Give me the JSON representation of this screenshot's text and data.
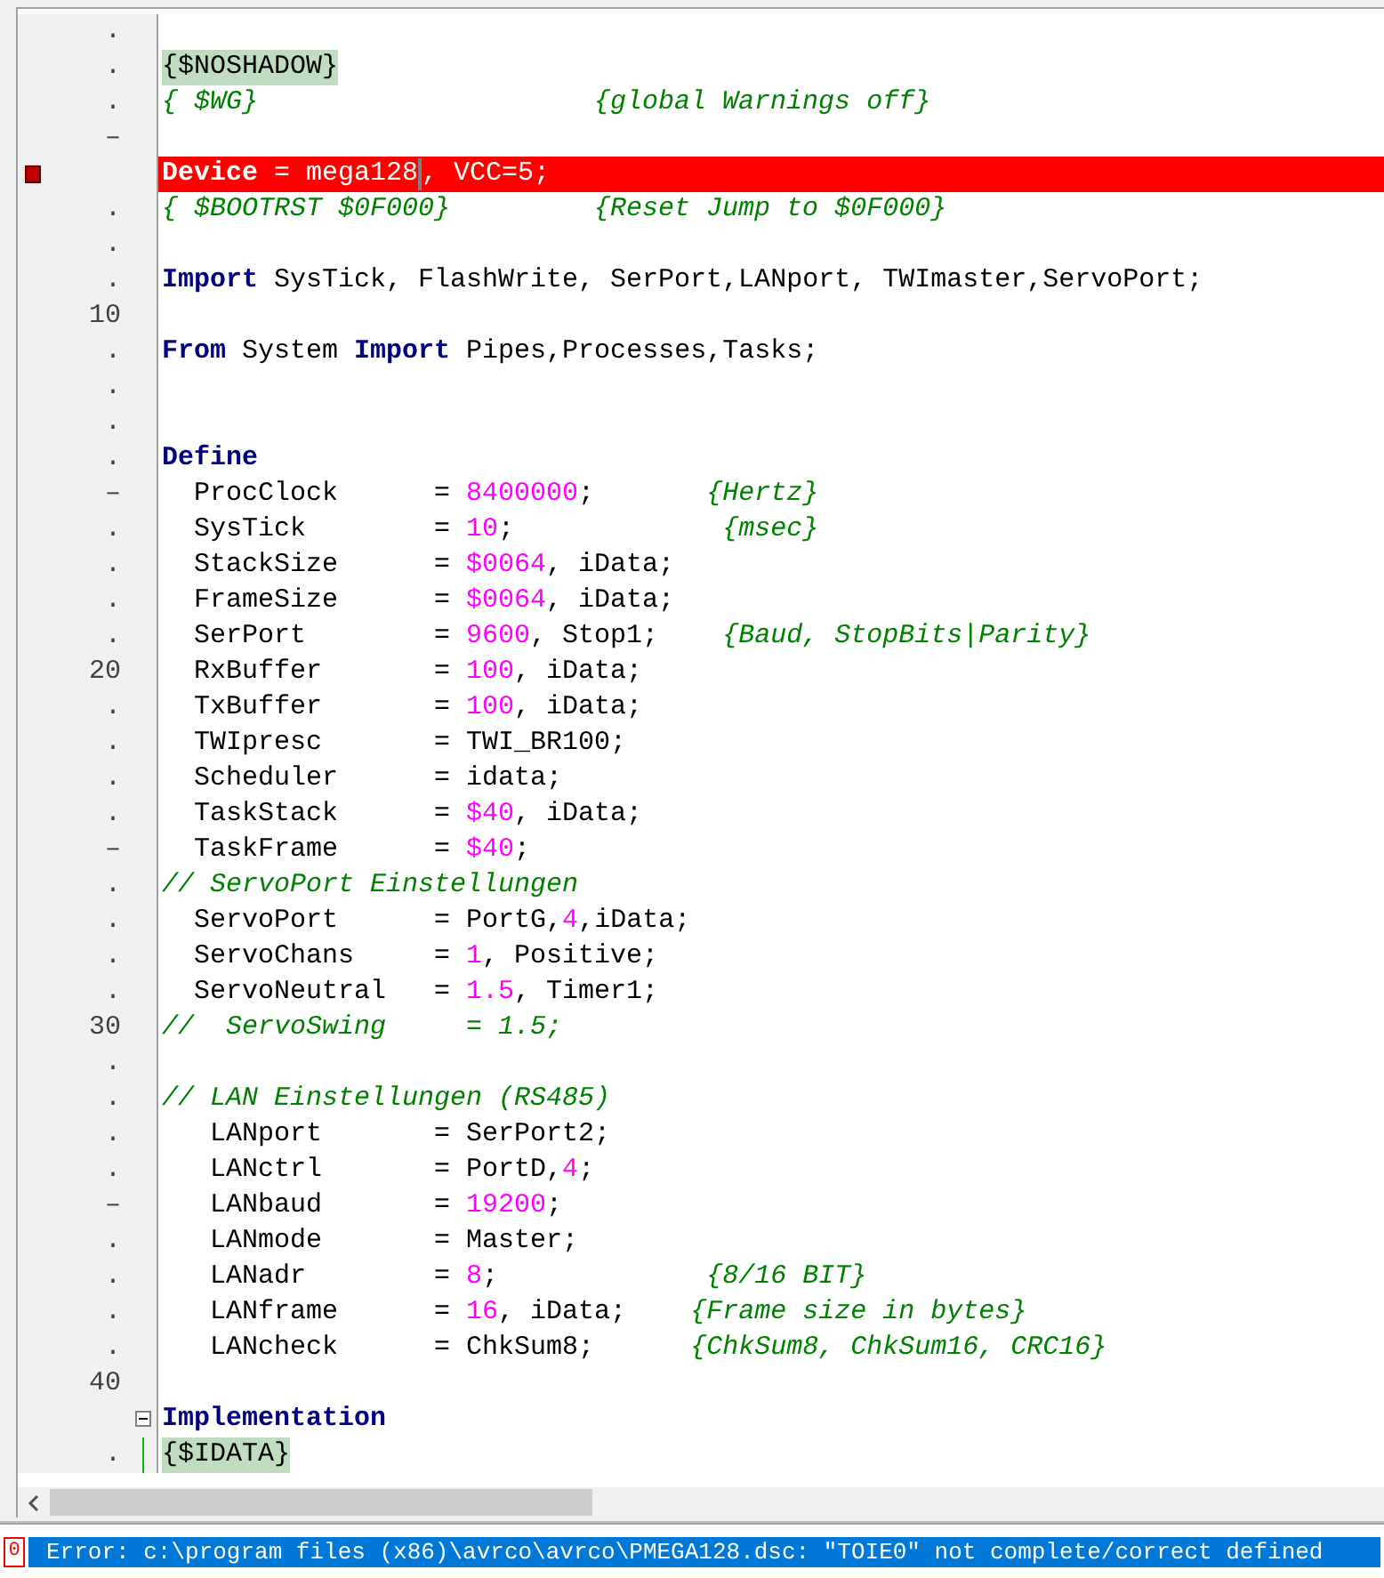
{
  "editor": {
    "lines": [
      {
        "gutter": {
          "kind": "text",
          "text": "."
        },
        "error": false
      },
      {
        "gutter": {
          "kind": "text",
          "text": "."
        },
        "error": false,
        "segments": [
          {
            "t": "{$NOSHADOW}",
            "kind": "directive"
          }
        ]
      },
      {
        "gutter": {
          "kind": "text",
          "text": "."
        },
        "error": false,
        "segments": [
          {
            "t": "{ $WG}                     {global Warnings off}",
            "kind": "comment"
          }
        ]
      },
      {
        "gutter": {
          "kind": "text",
          "text": "–"
        },
        "error": false
      },
      {
        "gutter": {
          "kind": "breakpoint"
        },
        "error": true,
        "segments": [
          {
            "t": "Device",
            "kind": "keyword"
          },
          {
            "t": " = mega128",
            "kind": "plain"
          },
          {
            "kind": "caret"
          },
          {
            "t": ", VCC=5;",
            "kind": "plain"
          }
        ]
      },
      {
        "gutter": {
          "kind": "text",
          "text": "."
        },
        "error": false,
        "segments": [
          {
            "t": "{ $BOOTRST $0F000}         {Reset Jump to $0F000}",
            "kind": "comment"
          }
        ]
      },
      {
        "gutter": {
          "kind": "text",
          "text": "."
        },
        "error": false
      },
      {
        "gutter": {
          "kind": "text",
          "text": "."
        },
        "error": false,
        "segments": [
          {
            "t": "Import",
            "kind": "keyword"
          },
          {
            "t": " SysTick, FlashWrite, SerPort,LANport, TWImaster,ServoPort;",
            "kind": "plain"
          }
        ]
      },
      {
        "gutter": {
          "kind": "text",
          "text": "10"
        },
        "error": false
      },
      {
        "gutter": {
          "kind": "text",
          "text": "."
        },
        "error": false,
        "segments": [
          {
            "t": "From",
            "kind": "keyword"
          },
          {
            "t": " System ",
            "kind": "plain"
          },
          {
            "t": "Import",
            "kind": "keyword"
          },
          {
            "t": " Pipes,Processes,Tasks;",
            "kind": "plain"
          }
        ]
      },
      {
        "gutter": {
          "kind": "text",
          "text": "."
        },
        "error": false
      },
      {
        "gutter": {
          "kind": "text",
          "text": "."
        },
        "error": false
      },
      {
        "gutter": {
          "kind": "text",
          "text": "."
        },
        "error": false,
        "segments": [
          {
            "t": "Define",
            "kind": "keyword"
          }
        ]
      },
      {
        "gutter": {
          "kind": "text",
          "text": "–"
        },
        "error": false,
        "segments": [
          {
            "t": "  ProcClock      = ",
            "kind": "plain"
          },
          {
            "t": "8400000",
            "kind": "number"
          },
          {
            "t": ";       ",
            "kind": "plain"
          },
          {
            "t": "{Hertz}",
            "kind": "comment"
          }
        ]
      },
      {
        "gutter": {
          "kind": "text",
          "text": "."
        },
        "error": false,
        "segments": [
          {
            "t": "  SysTick        = ",
            "kind": "plain"
          },
          {
            "t": "10",
            "kind": "number"
          },
          {
            "t": ";             ",
            "kind": "plain"
          },
          {
            "t": "{msec}",
            "kind": "comment"
          }
        ]
      },
      {
        "gutter": {
          "kind": "text",
          "text": "."
        },
        "error": false,
        "segments": [
          {
            "t": "  StackSize      = ",
            "kind": "plain"
          },
          {
            "t": "$0064",
            "kind": "number"
          },
          {
            "t": ", iData;",
            "kind": "plain"
          }
        ]
      },
      {
        "gutter": {
          "kind": "text",
          "text": "."
        },
        "error": false,
        "segments": [
          {
            "t": "  FrameSize      = ",
            "kind": "plain"
          },
          {
            "t": "$0064",
            "kind": "number"
          },
          {
            "t": ", iData;",
            "kind": "plain"
          }
        ]
      },
      {
        "gutter": {
          "kind": "text",
          "text": "."
        },
        "error": false,
        "segments": [
          {
            "t": "  SerPort        = ",
            "kind": "plain"
          },
          {
            "t": "9600",
            "kind": "number"
          },
          {
            "t": ", Stop1;    ",
            "kind": "plain"
          },
          {
            "t": "{Baud, StopBits|Parity}",
            "kind": "comment"
          }
        ]
      },
      {
        "gutter": {
          "kind": "text",
          "text": "20"
        },
        "error": false,
        "segments": [
          {
            "t": "  RxBuffer       = ",
            "kind": "plain"
          },
          {
            "t": "100",
            "kind": "number"
          },
          {
            "t": ", iData;",
            "kind": "plain"
          }
        ]
      },
      {
        "gutter": {
          "kind": "text",
          "text": "."
        },
        "error": false,
        "segments": [
          {
            "t": "  TxBuffer       = ",
            "kind": "plain"
          },
          {
            "t": "100",
            "kind": "number"
          },
          {
            "t": ", iData;",
            "kind": "plain"
          }
        ]
      },
      {
        "gutter": {
          "kind": "text",
          "text": "."
        },
        "error": false,
        "segments": [
          {
            "t": "  TWIpresc       = TWI_BR100;",
            "kind": "plain"
          }
        ]
      },
      {
        "gutter": {
          "kind": "text",
          "text": "."
        },
        "error": false,
        "segments": [
          {
            "t": "  Scheduler      = idata;",
            "kind": "plain"
          }
        ]
      },
      {
        "gutter": {
          "kind": "text",
          "text": "."
        },
        "error": false,
        "segments": [
          {
            "t": "  TaskStack      = ",
            "kind": "plain"
          },
          {
            "t": "$40",
            "kind": "number"
          },
          {
            "t": ", iData;",
            "kind": "plain"
          }
        ]
      },
      {
        "gutter": {
          "kind": "text",
          "text": "–"
        },
        "error": false,
        "segments": [
          {
            "t": "  TaskFrame      = ",
            "kind": "plain"
          },
          {
            "t": "$40",
            "kind": "number"
          },
          {
            "t": ";",
            "kind": "plain"
          }
        ]
      },
      {
        "gutter": {
          "kind": "text",
          "text": "."
        },
        "error": false,
        "segments": [
          {
            "t": "// ServoPort Einstellungen",
            "kind": "comment"
          }
        ]
      },
      {
        "gutter": {
          "kind": "text",
          "text": "."
        },
        "error": false,
        "segments": [
          {
            "t": "  ServoPort      = PortG,",
            "kind": "plain"
          },
          {
            "t": "4",
            "kind": "number"
          },
          {
            "t": ",iData;",
            "kind": "plain"
          }
        ]
      },
      {
        "gutter": {
          "kind": "text",
          "text": "."
        },
        "error": false,
        "segments": [
          {
            "t": "  ServoChans     = ",
            "kind": "plain"
          },
          {
            "t": "1",
            "kind": "number"
          },
          {
            "t": ", Positive;",
            "kind": "plain"
          }
        ]
      },
      {
        "gutter": {
          "kind": "text",
          "text": "."
        },
        "error": false,
        "segments": [
          {
            "t": "  ServoNeutral   = ",
            "kind": "plain"
          },
          {
            "t": "1.5",
            "kind": "number"
          },
          {
            "t": ", Timer1;",
            "kind": "plain"
          }
        ]
      },
      {
        "gutter": {
          "kind": "text",
          "text": "30"
        },
        "error": false,
        "segments": [
          {
            "t": "//  ServoSwing     = 1.5;",
            "kind": "comment"
          }
        ]
      },
      {
        "gutter": {
          "kind": "text",
          "text": "."
        },
        "error": false
      },
      {
        "gutter": {
          "kind": "text",
          "text": "."
        },
        "error": false,
        "segments": [
          {
            "t": "// LAN Einstellungen (RS485)",
            "kind": "comment"
          }
        ]
      },
      {
        "gutter": {
          "kind": "text",
          "text": "."
        },
        "error": false,
        "segments": [
          {
            "t": "   LANport       = SerPort2;",
            "kind": "plain"
          }
        ]
      },
      {
        "gutter": {
          "kind": "text",
          "text": "."
        },
        "error": false,
        "segments": [
          {
            "t": "   LANctrl       = PortD,",
            "kind": "plain"
          },
          {
            "t": "4",
            "kind": "number"
          },
          {
            "t": ";",
            "kind": "plain"
          }
        ]
      },
      {
        "gutter": {
          "kind": "text",
          "text": "–"
        },
        "error": false,
        "segments": [
          {
            "t": "   LANbaud       = ",
            "kind": "plain"
          },
          {
            "t": "19200",
            "kind": "number"
          },
          {
            "t": ";",
            "kind": "plain"
          }
        ]
      },
      {
        "gutter": {
          "kind": "text",
          "text": "."
        },
        "error": false,
        "segments": [
          {
            "t": "   LANmode       = Master;",
            "kind": "plain"
          }
        ]
      },
      {
        "gutter": {
          "kind": "text",
          "text": "."
        },
        "error": false,
        "segments": [
          {
            "t": "   LANadr        = ",
            "kind": "plain"
          },
          {
            "t": "8",
            "kind": "number"
          },
          {
            "t": ";             ",
            "kind": "plain"
          },
          {
            "t": "{8/16 BIT}",
            "kind": "comment"
          }
        ]
      },
      {
        "gutter": {
          "kind": "text",
          "text": "."
        },
        "error": false,
        "segments": [
          {
            "t": "   LANframe      = ",
            "kind": "plain"
          },
          {
            "t": "16",
            "kind": "number"
          },
          {
            "t": ", iData;    ",
            "kind": "plain"
          },
          {
            "t": "{Frame size in bytes}",
            "kind": "comment"
          }
        ]
      },
      {
        "gutter": {
          "kind": "text",
          "text": "."
        },
        "error": false,
        "segments": [
          {
            "t": "   LANcheck      = ChkSum8;      ",
            "kind": "plain"
          },
          {
            "t": "{ChkSum8, ChkSum16, CRC16}",
            "kind": "comment"
          }
        ]
      },
      {
        "gutter": {
          "kind": "text",
          "text": "40"
        },
        "error": false
      },
      {
        "gutter": {
          "kind": "fold"
        },
        "error": false,
        "segments": [
          {
            "t": "Implementation",
            "kind": "keyword"
          }
        ]
      },
      {
        "gutter": {
          "kind": "text",
          "text": "."
        },
        "error": false,
        "segments": [
          {
            "t": "{$IDATA}",
            "kind": "directive"
          }
        ]
      }
    ]
  },
  "messages": {
    "count": "0",
    "items": [
      {
        "text": "Error: c:\\program files (x86)\\avrco\\avrco\\PMEGA128.dsc: \"TOIE0\" not complete/correct defined",
        "selected": true
      }
    ]
  }
}
